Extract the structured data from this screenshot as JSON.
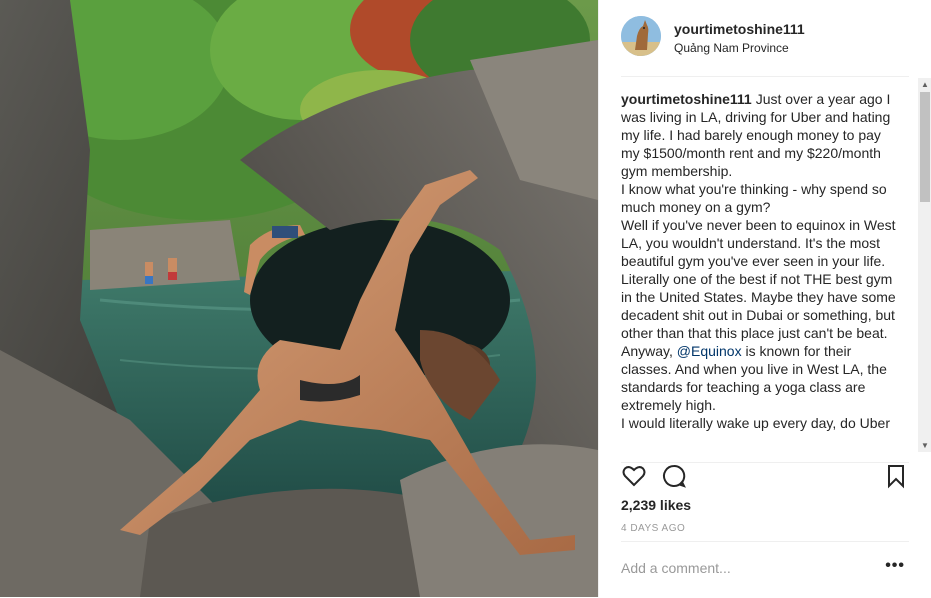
{
  "post": {
    "username": "yourtimetoshine111",
    "location": "Quảng Nam Province",
    "avatar_icon": "kangaroo-avatar",
    "photo_description_icon": "yoga-waterfall-photo"
  },
  "caption": {
    "username": "yourtimetoshine111",
    "para1": "Just over a year ago I was living in LA, driving for Uber and hating my life. I had barely enough money to pay my $1500/month rent and my $220/month gym membership.",
    "para2": "I know what you're thinking - why spend so much money on a gym?",
    "para3": "Well if you've never been to equinox in West LA, you wouldn't understand. It's the most beautiful gym you've ever seen in your life. Literally one of the best if not THE best gym in the United States. Maybe they have some decadent shit out in Dubai or something, but other than that this place just can't be beat.",
    "para4_start": "Anyway, ",
    "para4_mention": "@Equinox",
    "para4_end": " is known for their classes. And when you live in West LA, the standards for teaching a yoga class are extremely high.",
    "para5": "I would literally wake up every day, do Uber"
  },
  "actions": {
    "like_icon": "heart-icon",
    "comment_icon": "comment-icon",
    "save_icon": "bookmark-icon"
  },
  "likes": "2,239 likes",
  "age": "4 DAYS AGO",
  "comment": {
    "placeholder": "Add a comment...",
    "more_label": "•••"
  },
  "colors": {
    "text": "#262626",
    "muted": "#999999",
    "mention": "#003569",
    "divider": "#efefef"
  }
}
